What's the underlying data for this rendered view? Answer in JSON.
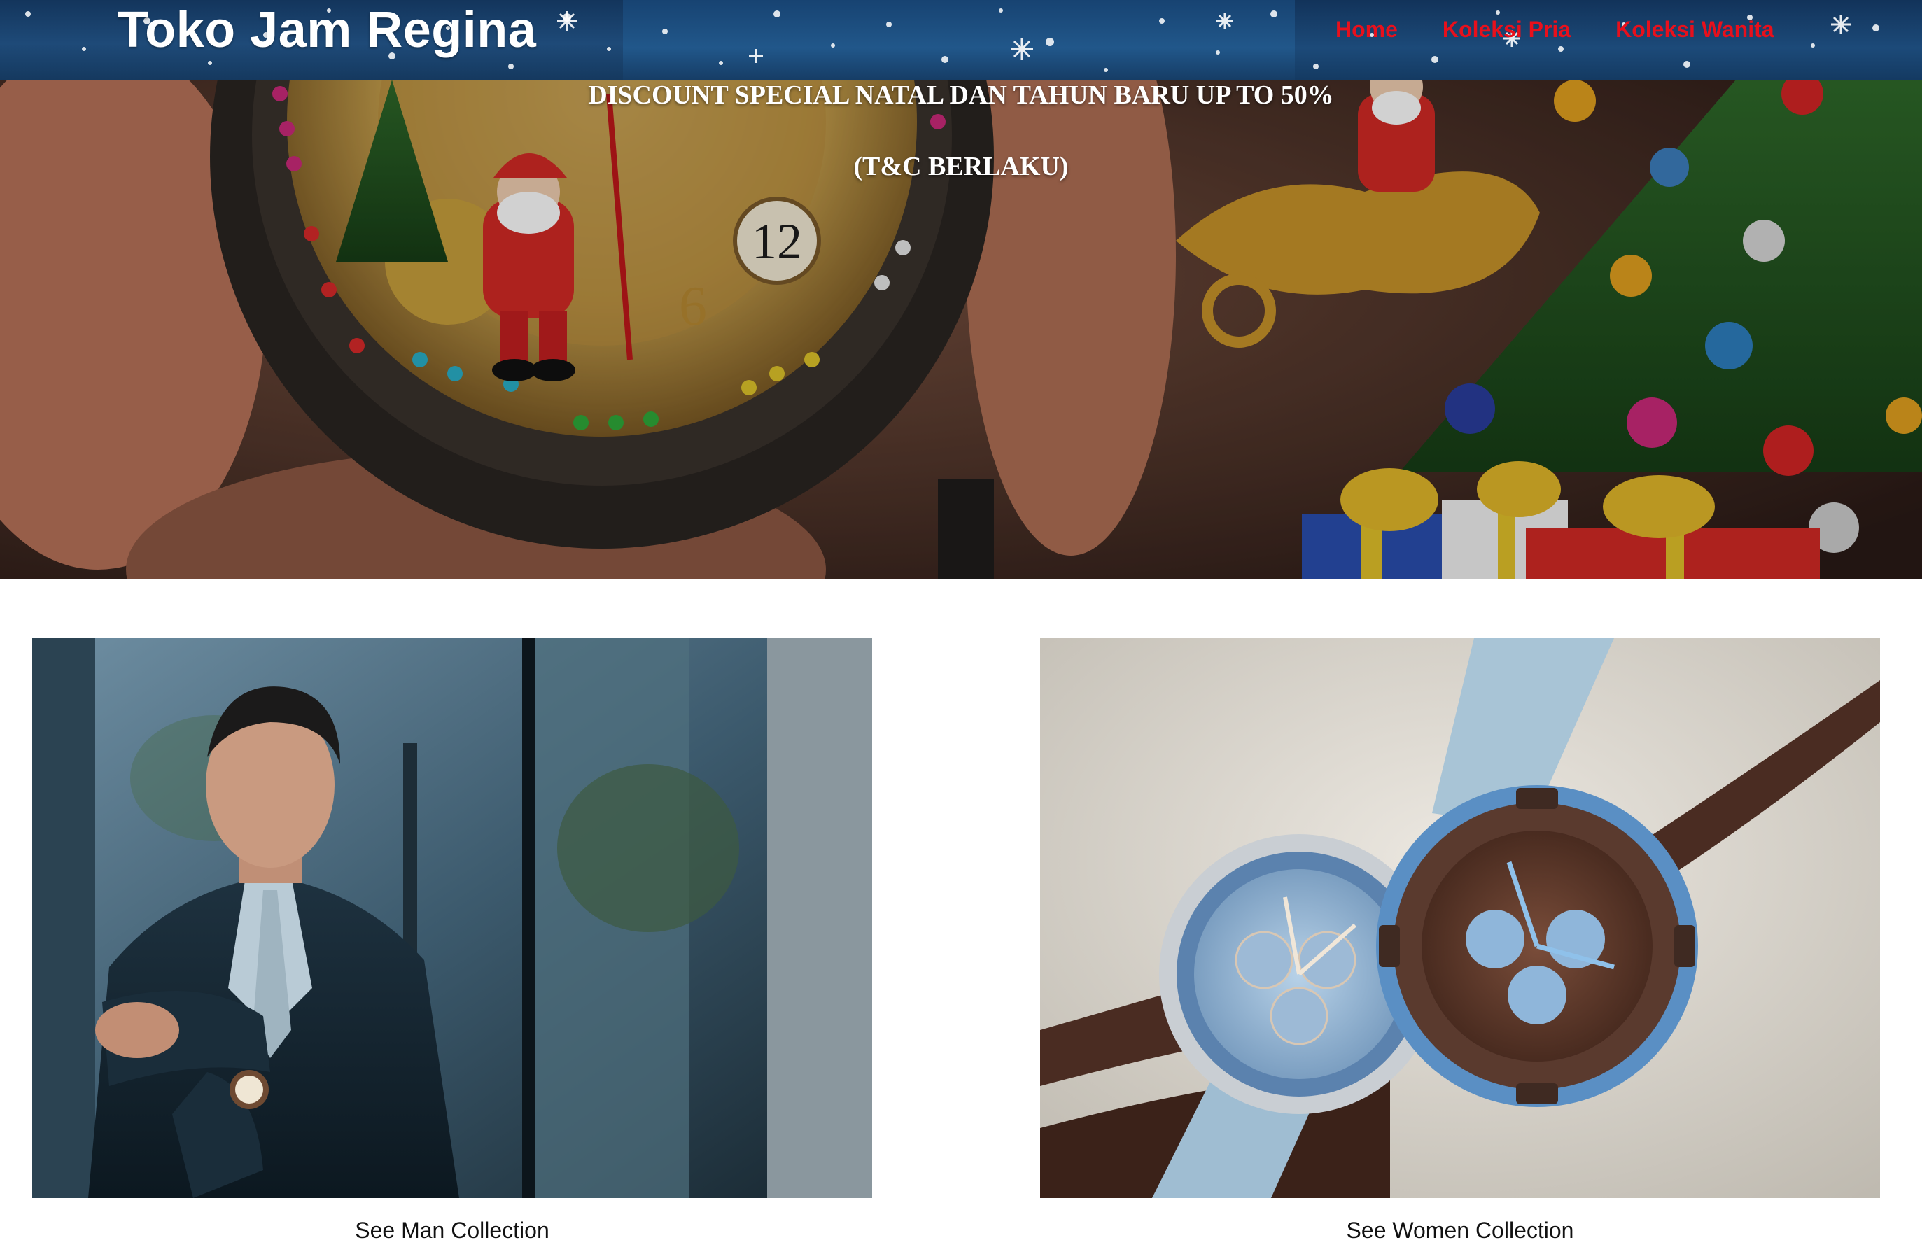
{
  "header": {
    "site_title": "Toko Jam Regina",
    "nav": [
      {
        "label": "Home"
      },
      {
        "label": "Koleksi Pria"
      },
      {
        "label": "Koleksi Wanita"
      }
    ],
    "nav_color": "#e8101c"
  },
  "hero": {
    "headline": "DISCOUNT SPECIAL NATAL DAN TAHUN BARU UP TO 50%",
    "subline": "(T&C BERLAKU)"
  },
  "collections": [
    {
      "caption": "See Man Collection"
    },
    {
      "caption": "See Women Collection"
    }
  ]
}
